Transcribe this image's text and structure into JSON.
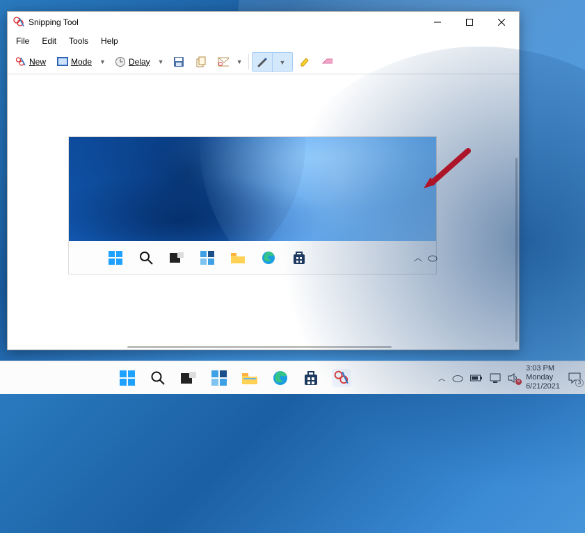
{
  "window": {
    "title": "Snipping Tool",
    "menu": {
      "file": "File",
      "edit": "Edit",
      "tools": "Tools",
      "help": "Help"
    },
    "toolbar": {
      "new_label": "New",
      "mode_label": "Mode",
      "delay_label": "Delay"
    }
  },
  "taskbar": {
    "time": "3:03 PM",
    "day": "Monday",
    "date": "6/21/2021",
    "notif_count": "3"
  }
}
